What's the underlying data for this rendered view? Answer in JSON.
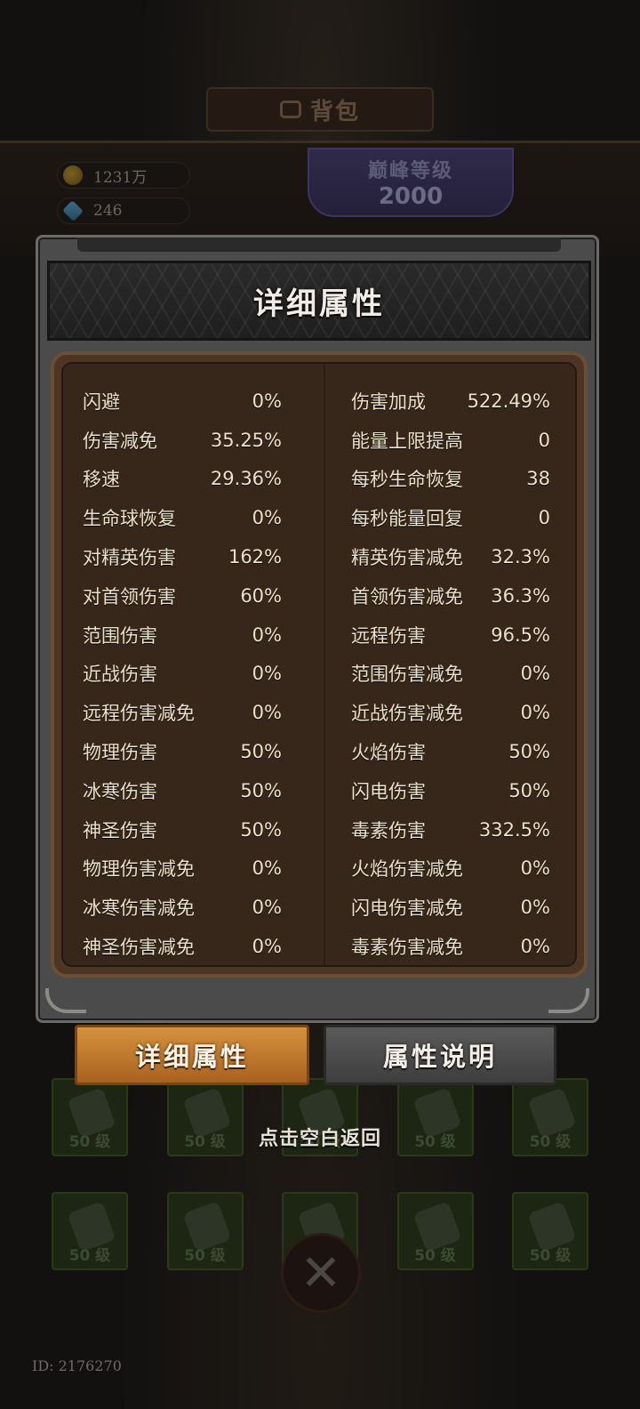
{
  "background": {
    "bag_title": "背包",
    "gold": "1231万",
    "gems": "246",
    "peak_label": "巅峰等级",
    "peak_value": "2000",
    "slot_level": "50 级",
    "player_id": "ID: 2176270"
  },
  "modal": {
    "title": "详细属性",
    "stats": [
      {
        "left_name": "闪避",
        "left_value": "0%",
        "right_name": "伤害加成",
        "right_value": "522.49%"
      },
      {
        "left_name": "伤害减免",
        "left_value": "35.25%",
        "right_name": "能量上限提高",
        "right_value": "0"
      },
      {
        "left_name": "移速",
        "left_value": "29.36%",
        "right_name": "每秒生命恢复",
        "right_value": "38"
      },
      {
        "left_name": "生命球恢复",
        "left_value": "0%",
        "right_name": "每秒能量回复",
        "right_value": "0"
      },
      {
        "left_name": "对精英伤害",
        "left_value": "162%",
        "right_name": "精英伤害减免",
        "right_value": "32.3%"
      },
      {
        "left_name": "对首领伤害",
        "left_value": "60%",
        "right_name": "首领伤害减免",
        "right_value": "36.3%"
      },
      {
        "left_name": "范围伤害",
        "left_value": "0%",
        "right_name": "远程伤害",
        "right_value": "96.5%"
      },
      {
        "left_name": "近战伤害",
        "left_value": "0%",
        "right_name": "范围伤害减免",
        "right_value": "0%"
      },
      {
        "left_name": "远程伤害减免",
        "left_value": "0%",
        "right_name": "近战伤害减免",
        "right_value": "0%"
      },
      {
        "left_name": "物理伤害",
        "left_value": "50%",
        "right_name": "火焰伤害",
        "right_value": "50%"
      },
      {
        "left_name": "冰寒伤害",
        "left_value": "50%",
        "right_name": "闪电伤害",
        "right_value": "50%"
      },
      {
        "left_name": "神圣伤害",
        "left_value": "50%",
        "right_name": "毒素伤害",
        "right_value": "332.5%"
      },
      {
        "left_name": "物理伤害减免",
        "left_value": "0%",
        "right_name": "火焰伤害减免",
        "right_value": "0%"
      },
      {
        "left_name": "冰寒伤害减免",
        "left_value": "0%",
        "right_name": "闪电伤害减免",
        "right_value": "0%"
      },
      {
        "left_name": "神圣伤害减免",
        "left_value": "0%",
        "right_name": "毒素伤害减免",
        "right_value": "0%"
      }
    ]
  },
  "tabs": {
    "detail": "详细属性",
    "explain": "属性说明"
  },
  "hint": "点击空白返回",
  "icons": {
    "gold": "gold-coin-icon",
    "gem": "diamond-icon",
    "bag": "bag-icon",
    "close": "close-icon"
  },
  "colors": {
    "active_tab": "#c27a30",
    "inactive_tab": "#4a4a4a",
    "panel_brown": "#37271a"
  }
}
